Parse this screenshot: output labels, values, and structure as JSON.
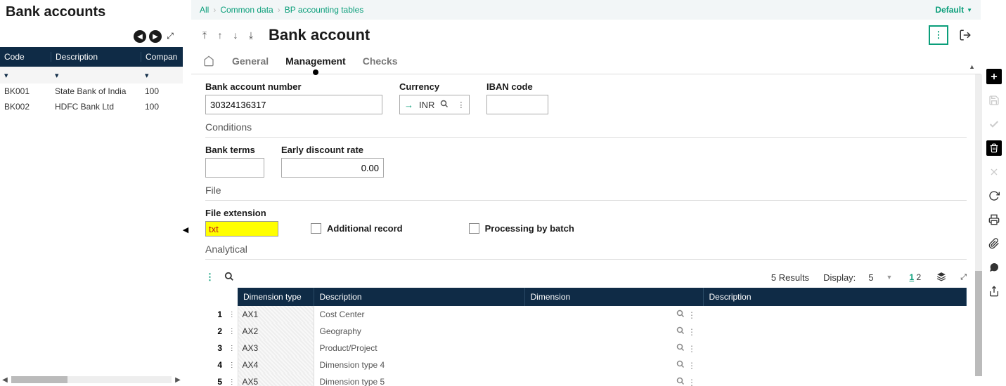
{
  "leftPanel": {
    "title": "Bank accounts",
    "headers": {
      "code": "Code",
      "description": "Description",
      "company": "Compan"
    },
    "rows": [
      {
        "code": "BK001",
        "description": "State Bank of India",
        "company": "100"
      },
      {
        "code": "BK002",
        "description": "HDFC Bank Ltd",
        "company": "100"
      }
    ]
  },
  "breadcrumb": {
    "all": "All",
    "commonData": "Common data",
    "bpTables": "BP accounting tables",
    "default": "Default"
  },
  "mainTitle": "Bank account",
  "tabs": {
    "general": "General",
    "management": "Management",
    "checks": "Checks"
  },
  "fields": {
    "bankAcctNumLabel": "Bank account number",
    "bankAcctNumValue": "30324136317",
    "currencyLabel": "Currency",
    "currencyValue": "INR",
    "ibanLabel": "IBAN code",
    "ibanValue": ""
  },
  "conditions": {
    "section": "Conditions",
    "bankTermsLabel": "Bank terms",
    "bankTermsValue": "",
    "discRateLabel": "Early discount rate",
    "discRateValue": "0.00"
  },
  "file": {
    "section": "File",
    "fileExtLabel": "File extension",
    "fileExtValue": "txt",
    "additionalRecordLabel": "Additional record",
    "processingBatchLabel": "Processing by batch"
  },
  "analytical": {
    "section": "Analytical",
    "resultsText": "5 Results",
    "displayLabel": "Display:",
    "displayValue": "5",
    "page1": "1",
    "page2": "2",
    "headers": {
      "dimType": "Dimension type",
      "desc1": "Description",
      "dim": "Dimension",
      "desc2": "Description"
    },
    "rows": [
      {
        "n": "1",
        "type": "AX1",
        "desc": "Cost Center"
      },
      {
        "n": "2",
        "type": "AX2",
        "desc": "Geography"
      },
      {
        "n": "3",
        "type": "AX3",
        "desc": "Product/Project"
      },
      {
        "n": "4",
        "type": "AX4",
        "desc": "Dimension type 4"
      },
      {
        "n": "5",
        "type": "AX5",
        "desc": "Dimension type 5"
      }
    ]
  }
}
